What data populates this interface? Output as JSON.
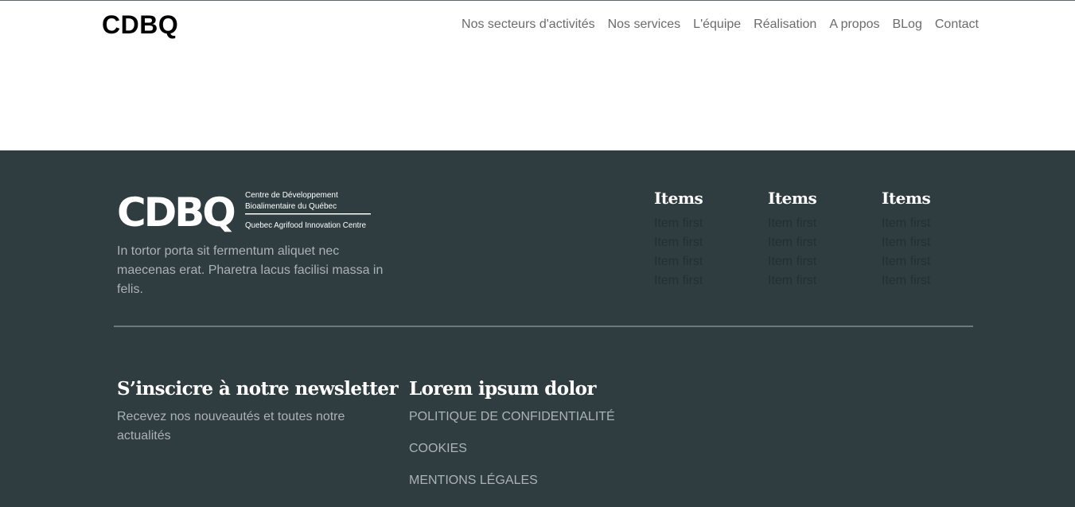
{
  "header": {
    "brand": "CDBQ",
    "nav": [
      "Nos secteurs d'activités",
      "Nos services",
      "L'équipe",
      "Réalisation",
      "A propos",
      "BLog",
      "Contact"
    ]
  },
  "footer": {
    "logo": {
      "mark": "CDBQ",
      "line1": "Centre de Développement",
      "line2": "Bioalimentaire du Québec",
      "line3": "Quebec Agrifood Innovation Centre"
    },
    "about": "In tortor porta sit fermentum aliquet nec maecenas erat. Pharetra lacus facilisi massa in felis.",
    "columns": [
      {
        "title": "Items",
        "items": [
          "Item first",
          "Item first",
          "Item first",
          "Item first"
        ]
      },
      {
        "title": "Items",
        "items": [
          "Item first",
          "Item first",
          "Item first",
          "Item first"
        ]
      },
      {
        "title": "Items",
        "items": [
          "Item first",
          "Item first",
          "Item first",
          "Item first"
        ]
      }
    ],
    "newsletter": {
      "title": "S’inscicre à notre newsletter",
      "text": "Recevez nos nouveautés et toutes notre actualités"
    },
    "legal": {
      "title": "Lorem ipsum dolor",
      "links": [
        "POLITIQUE DE CONFIDENTIALITÉ",
        "COOKIES",
        "MENTIONS LÉGALES"
      ]
    }
  },
  "colors": {
    "footer_bg": "#2f3c40",
    "muted_text": "#aab3b5",
    "link_dark": "#252f32",
    "nav_text": "#6b6b6b"
  }
}
